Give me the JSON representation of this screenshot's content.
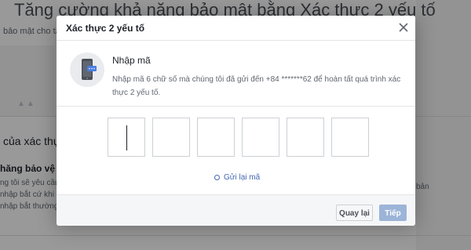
{
  "background_page": {
    "title": "Tăng cường khả năng bảo mật bằng Xác thực 2 yếu tố",
    "subtitle": "bảo mật cho tà",
    "section_heading": "của xác thự",
    "subheading": "hăng bảo vệ b",
    "lines": [
      "ng tôi sẽ yêu cầu t",
      "nhập bắt cứ khi n",
      "nhập bắt thường"
    ],
    "right_text": "bản"
  },
  "dialog": {
    "title": "Xác thực 2 yếu tố",
    "close_icon": "close-icon",
    "illustration_icon": "phone-with-code-icon",
    "section_title": "Nhập mã",
    "description": "Nhập mã 6 chữ số mà chúng tôi đã gửi đến +84 *******62 để hoàn tất quá trình xác thực 2 yếu tố.",
    "code_inputs": [
      "",
      "",
      "",
      "",
      "",
      ""
    ],
    "resend": {
      "icon": "refresh-icon",
      "label": "Gửi lại mã"
    },
    "footer": {
      "back_label": "Quay lại",
      "next_label": "Tiếp"
    }
  },
  "colors": {
    "link": "#4267b2",
    "next_button_disabled": "#9cb4d8",
    "overlay": "rgba(0,0,0,0.40)"
  }
}
